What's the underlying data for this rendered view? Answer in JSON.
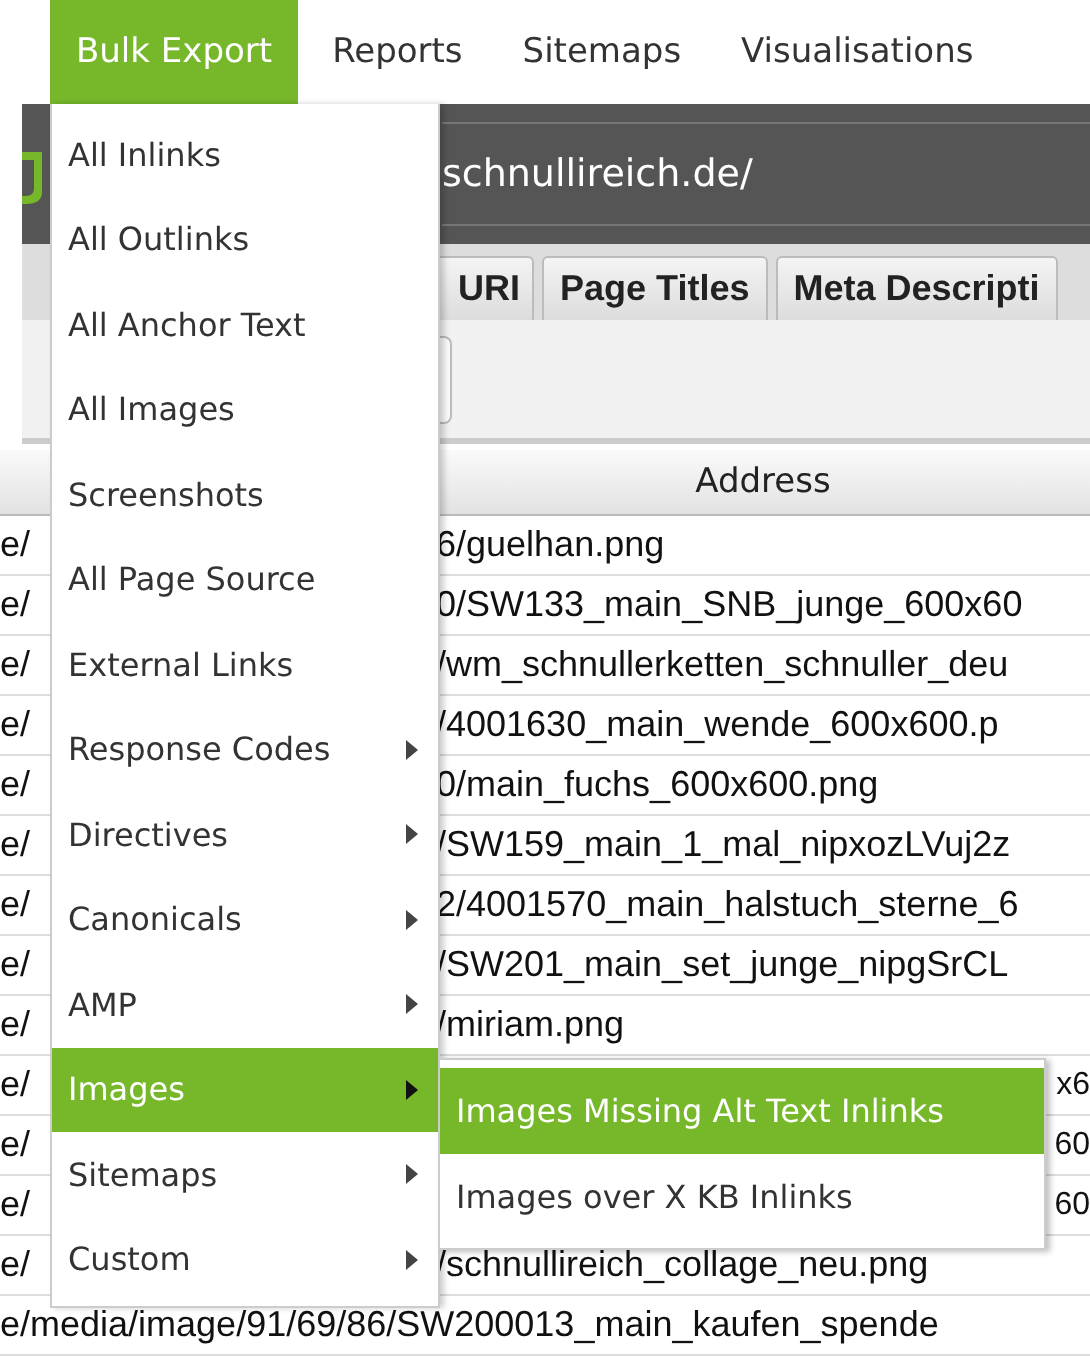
{
  "menu_bar": [
    {
      "label": "Bulk Export",
      "selected": true
    },
    {
      "label": "Reports",
      "selected": false
    },
    {
      "label": "Sitemaps",
      "selected": false
    },
    {
      "label": "Visualisations",
      "selected": false
    }
  ],
  "url_field": {
    "value": "schnullireich.de/"
  },
  "tabs": [
    {
      "label": "URI",
      "selected": false
    },
    {
      "label": "Page Titles",
      "selected": false
    },
    {
      "label": "Meta Descripti",
      "selected": false
    }
  ],
  "table": {
    "columns": [
      "Address"
    ],
    "rows": [
      {
        "kind": "split",
        "column_1": "e/",
        "address": "6/guelhan.png"
      },
      {
        "kind": "split",
        "column_1": "e/",
        "address": "0/SW133_main_SNB_junge_600x60"
      },
      {
        "kind": "split",
        "column_1": "e/",
        "address": "/wm_schnullerketten_schnuller_deu"
      },
      {
        "kind": "split",
        "column_1": "e/",
        "address": "/4001630_main_wende_600x600.p"
      },
      {
        "kind": "split",
        "column_1": "e/",
        "address": "0/main_fuchs_600x600.png"
      },
      {
        "kind": "split",
        "column_1": "e/",
        "address": "/SW159_main_1_mal_nipxozLVuj2z"
      },
      {
        "kind": "split",
        "column_1": "e/",
        "address": "2/4001570_main_halstuch_sterne_6"
      },
      {
        "kind": "split",
        "column_1": "e/",
        "address": "/SW201_main_set_junge_nipgSrCL"
      },
      {
        "kind": "split",
        "column_1": "e/",
        "address": "/miriam.png"
      },
      {
        "kind": "tail",
        "column_1": "e/",
        "address": "x6"
      },
      {
        "kind": "tail",
        "column_1": "e/",
        "address": "60"
      },
      {
        "kind": "tail",
        "column_1": "e/",
        "address": "60"
      },
      {
        "kind": "split",
        "column_1": "e/",
        "address": "/schnullireich_collage_neu.png"
      },
      {
        "kind": "full",
        "address": "e/media/image/91/69/86/SW200013_main_kaufen_spende"
      }
    ]
  },
  "dropdown": {
    "items": [
      {
        "label": "All Inlinks",
        "submenu": false,
        "selected": false
      },
      {
        "label": "All Outlinks",
        "submenu": false,
        "selected": false
      },
      {
        "label": "All Anchor Text",
        "submenu": false,
        "selected": false
      },
      {
        "label": "All Images",
        "submenu": false,
        "selected": false
      },
      {
        "label": "Screenshots",
        "submenu": false,
        "selected": false
      },
      {
        "label": "All Page Source",
        "submenu": false,
        "selected": false
      },
      {
        "label": "External Links",
        "submenu": false,
        "selected": false
      },
      {
        "label": "Response Codes",
        "submenu": true,
        "selected": false
      },
      {
        "label": "Directives",
        "submenu": true,
        "selected": false
      },
      {
        "label": "Canonicals",
        "submenu": true,
        "selected": false
      },
      {
        "label": "AMP",
        "submenu": true,
        "selected": false
      },
      {
        "label": "Images",
        "submenu": true,
        "selected": true
      },
      {
        "label": "Sitemaps",
        "submenu": true,
        "selected": false
      },
      {
        "label": "Custom",
        "submenu": true,
        "selected": false
      }
    ]
  },
  "submenu": {
    "items": [
      {
        "label": "Images Missing Alt Text Inlinks",
        "selected": true
      },
      {
        "label": "Images over X KB Inlinks",
        "selected": false
      }
    ]
  }
}
